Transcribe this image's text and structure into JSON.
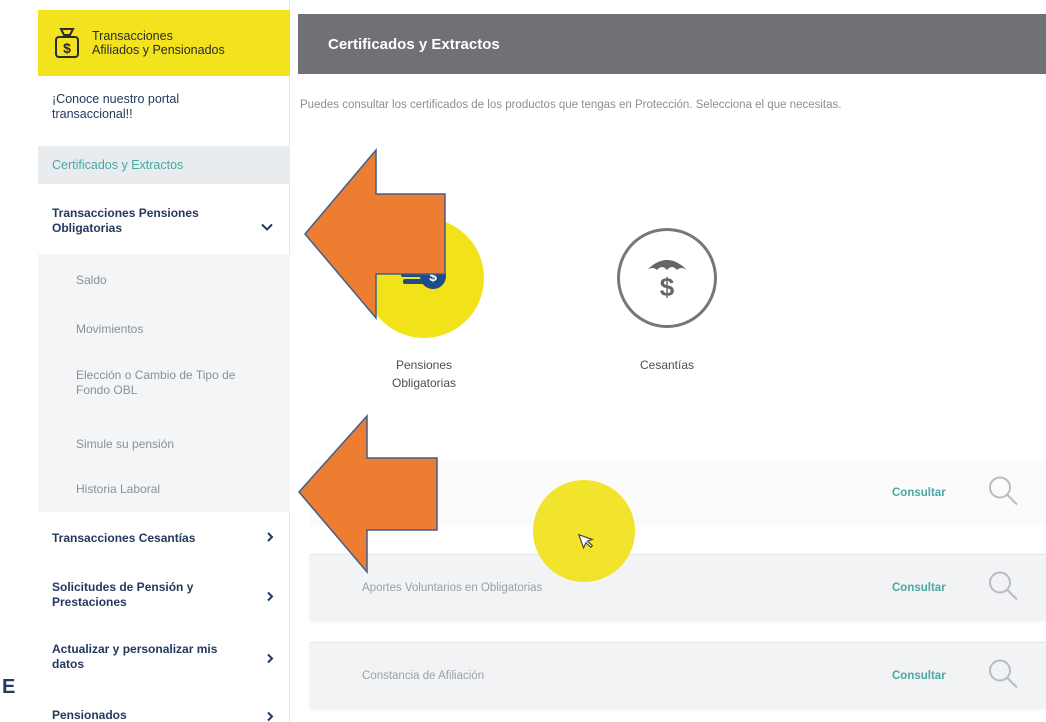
{
  "sidebar": {
    "header_line1": "Transacciones",
    "header_line2": "Afiliados y Pensionados",
    "items": {
      "portal": "¡Conoce nuestro portal transaccional!!",
      "certificados": "Certificados y Extractos",
      "pensiones": "Transacciones Pensiones Obligatorias",
      "saldo": "Saldo",
      "movimientos": "Movimientos",
      "eleccion": "Elección o Cambio de Tipo de Fondo OBL",
      "simule": "Simule su pensión",
      "historia": "Historia Laboral",
      "cesantias": "Transacciones Cesantías",
      "solicitudes": "Solicitudes de Pensión y Prestaciones",
      "actualizar": "Actualizar y personalizar mis datos",
      "pensionados": "Pensionados"
    }
  },
  "main": {
    "title": "Certificados y Extractos",
    "intro": "Puedes consultar los certificados de los productos que tengas en Protección. Selecciona el que necesitas.",
    "products": {
      "pensiones_l1": "Pensiones",
      "pensiones_l2": "Obligatorias",
      "cesantias": "Cesantías"
    },
    "rows": {
      "r1_label": "",
      "r2_label": "Aportes Voluntarios en Obligatorias",
      "r3_label": "Constancia de Afiliación",
      "consult": "Consultar"
    }
  },
  "edge_letter": "E",
  "colors": {
    "brand_yellow": "#f1e21a",
    "arrow_orange": "#ed7d31",
    "arrow_outline": "#3f5f8f",
    "topbar_gray": "#6f7175",
    "teal": "#4aa7a4"
  }
}
